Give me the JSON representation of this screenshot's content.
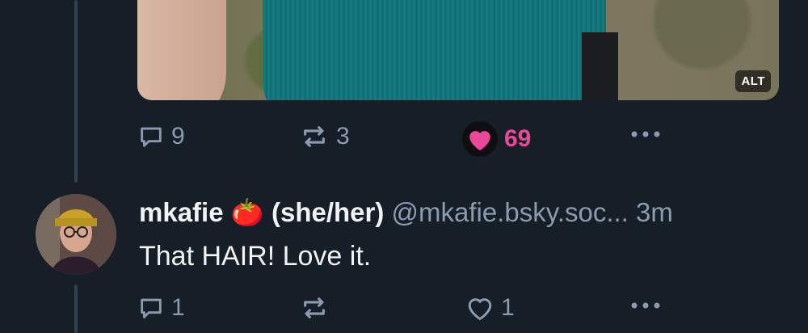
{
  "media": {
    "alt_badge": "ALT"
  },
  "post1": {
    "actions": {
      "replies": "9",
      "reposts": "3",
      "likes": "69"
    },
    "liked_color": "#ec4899"
  },
  "post2": {
    "author_name": "mkafie",
    "author_emoji": "🍅",
    "pronouns": "(she/her)",
    "handle": "@mkafie.bsky.soc...",
    "time": "3m",
    "text": "That HAIR! Love it.",
    "actions": {
      "replies": "1",
      "reposts": "",
      "likes": "1"
    }
  },
  "colors": {
    "background": "#161e27",
    "muted": "#8b9bb0",
    "accent_like": "#ec4899"
  }
}
